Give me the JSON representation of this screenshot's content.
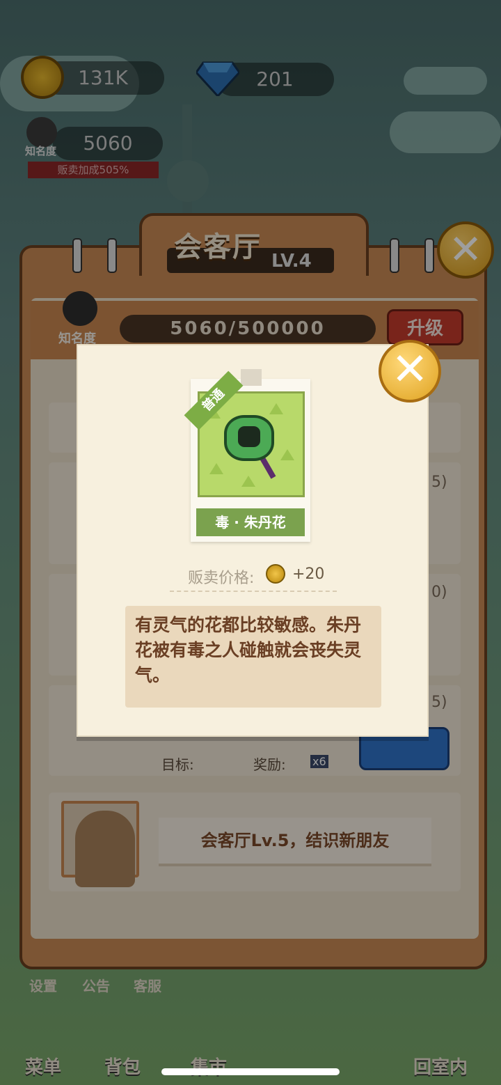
{
  "hud": {
    "coins": "131K",
    "gems": "201",
    "fame_value": "5060",
    "fame_label": "知名度",
    "sell_bonus": "贩卖加成505%"
  },
  "panel": {
    "title": "会客厅",
    "level": "LV.4",
    "fame_label": "知名度",
    "progress": "5060/500000",
    "upgrade_label": "升级",
    "target_label": "目标:",
    "reward_label": "奖励:",
    "reward_count": "x6",
    "partial_markers": [
      "5)",
      "0)",
      "5)"
    ],
    "next_level_text": "会客厅Lv.5，结识新朋友"
  },
  "dialog": {
    "rarity": "普通",
    "item_name": "毒 · 朱丹花",
    "price_label": "贩卖价格:",
    "price_value": "+20",
    "description": "有灵气的花都比较敏感。朱丹花被有毒之人碰触就会丧失灵气。"
  },
  "bottom": {
    "menu_small": [
      "设置",
      "公告",
      "客服"
    ],
    "menu": "菜单",
    "backpack": "背包",
    "market": "集市",
    "home": "回室内"
  },
  "colors": {
    "panel_brown": "#c98a54",
    "upgrade_red": "#c33b2d",
    "item_green": "#7ba24e",
    "desc_text": "#6a3f24",
    "close_gold": "#dfa220"
  },
  "icons": [
    "coin-icon",
    "gem-icon",
    "close-icon",
    "flower-icon",
    "avatar-icon"
  ]
}
